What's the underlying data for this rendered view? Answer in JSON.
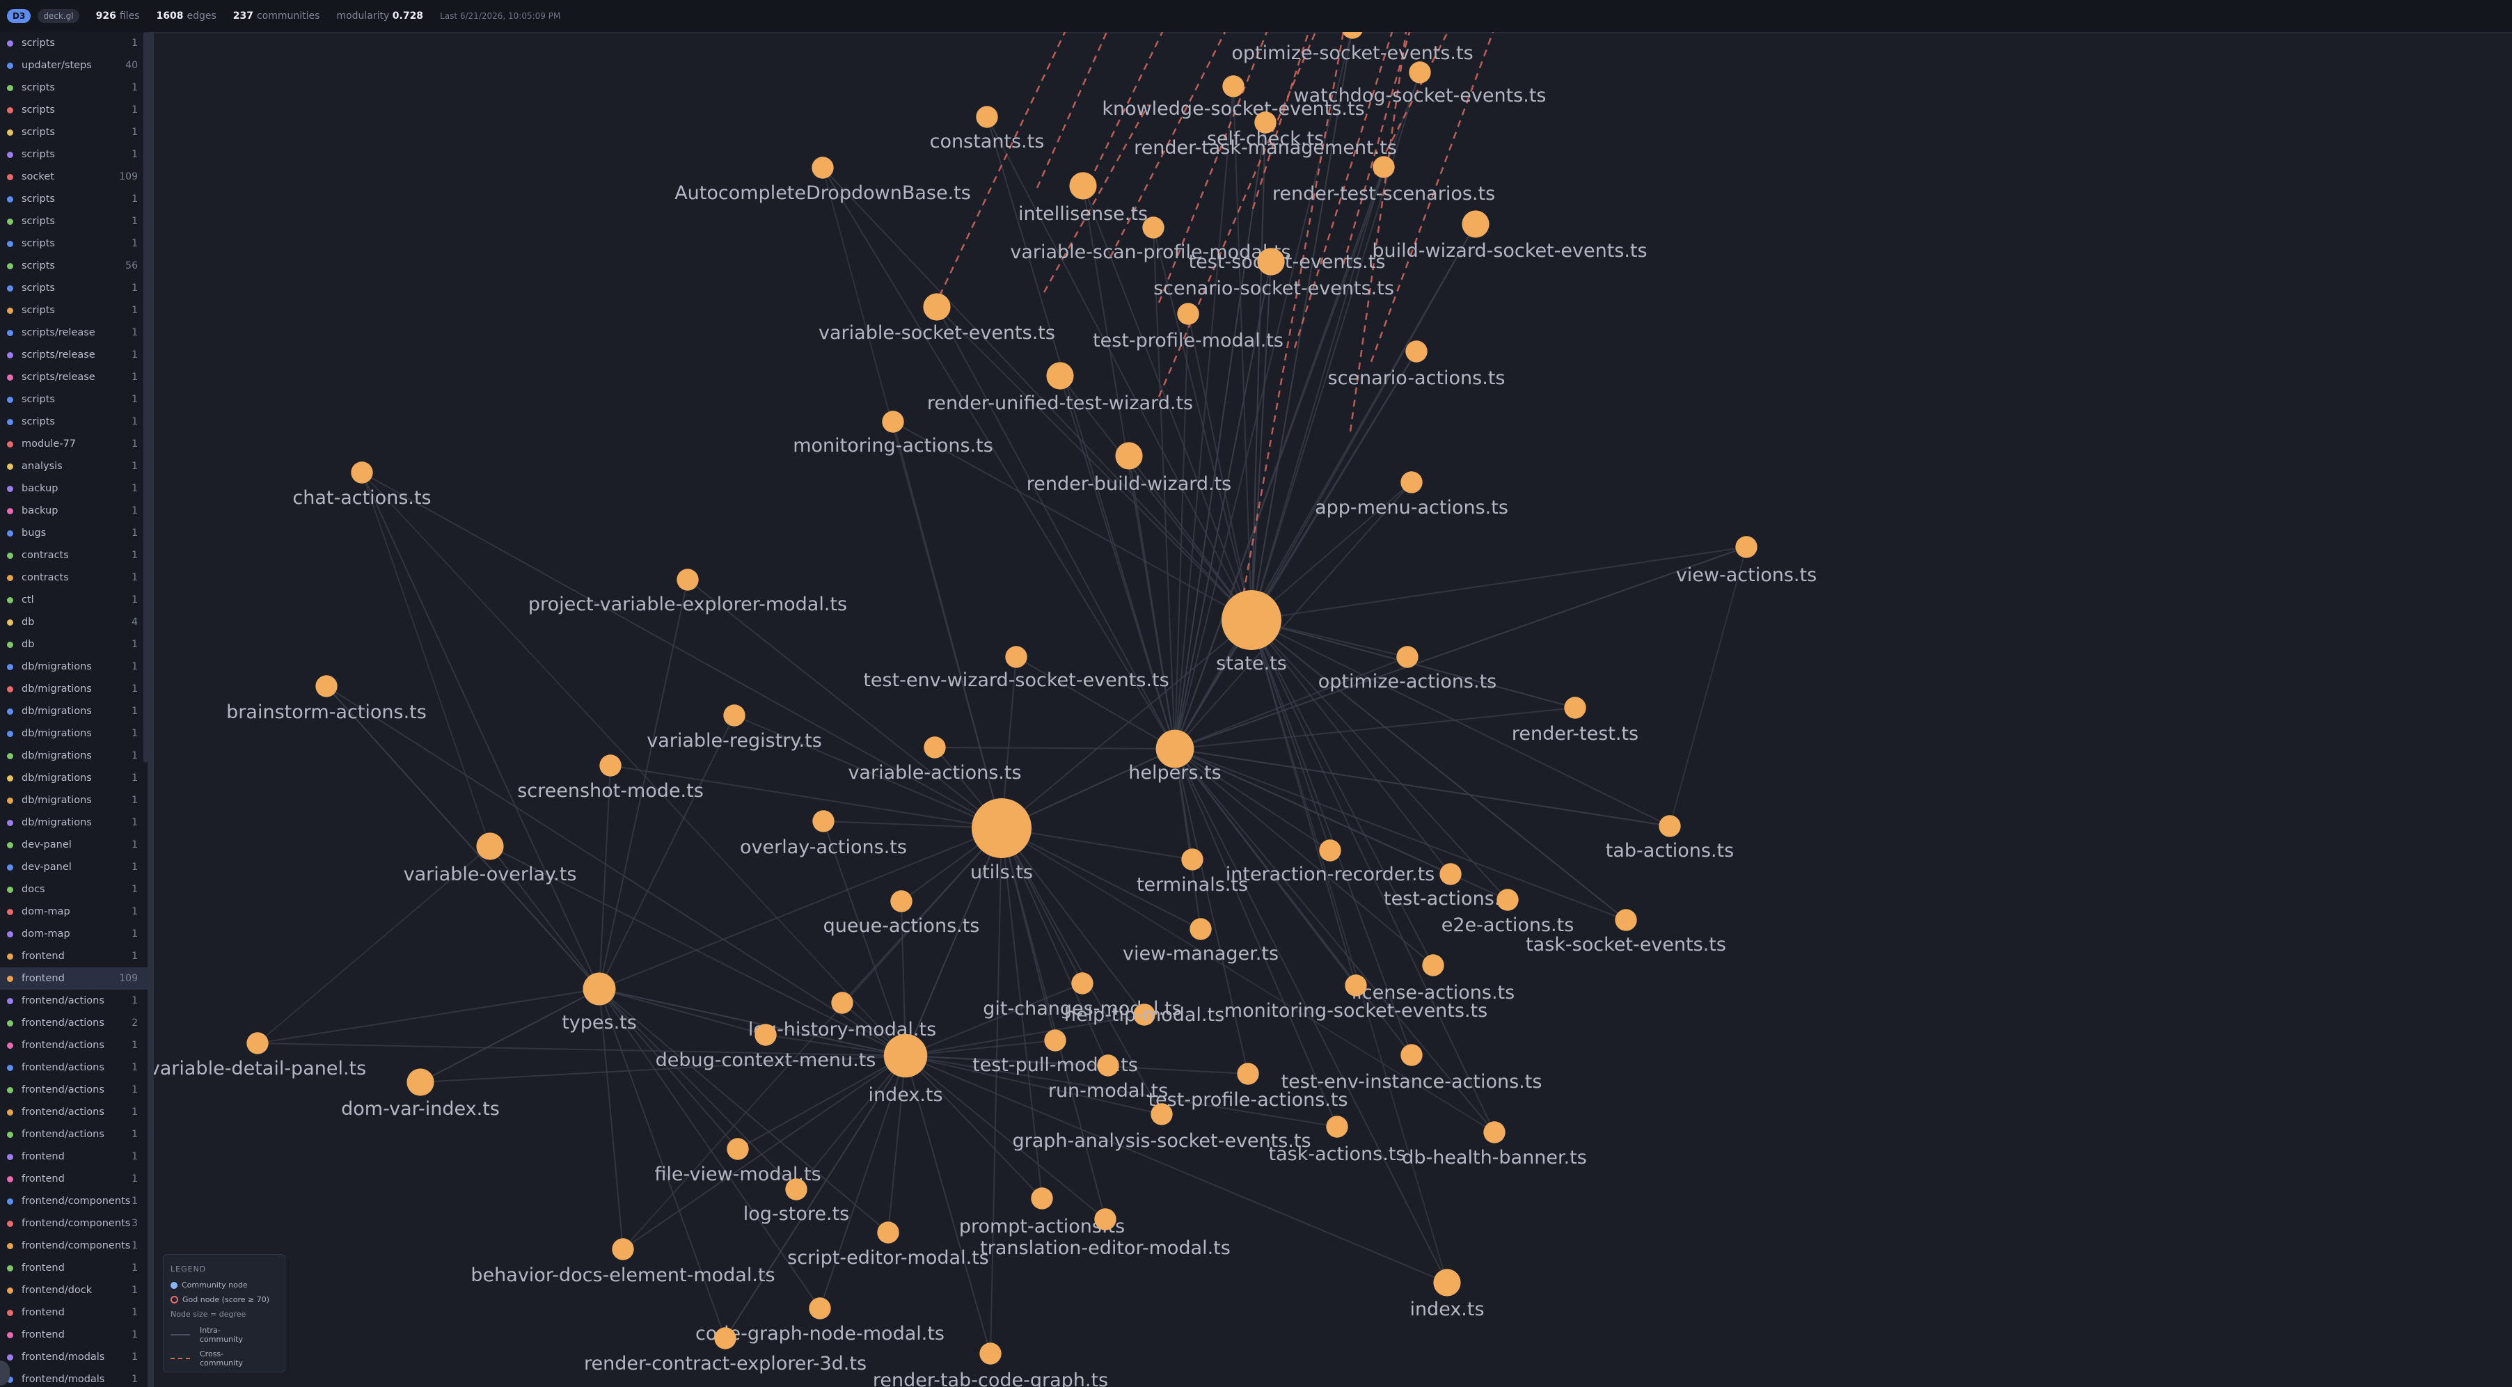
{
  "topbar": {
    "tabs": [
      {
        "label": "D3",
        "active": true
      },
      {
        "label": "deck.gl",
        "active": false
      }
    ],
    "stats": [
      {
        "value": "926",
        "label": "files"
      },
      {
        "value": "1608",
        "label": "edges"
      },
      {
        "value": "237",
        "label": "communities"
      },
      {
        "label": "modularity",
        "value": "0.728"
      }
    ],
    "last_updated": "Last 6/21/2026, 10:05:09 PM"
  },
  "sidebar": {
    "items": [
      {
        "name": "scripts",
        "count": "1",
        "color": "#9b7bf0"
      },
      {
        "name": "updater/steps",
        "count": "40",
        "color": "#5d8df0"
      },
      {
        "name": "scripts",
        "count": "1",
        "color": "#7ec86a"
      },
      {
        "name": "scripts",
        "count": "1",
        "color": "#e86a6a"
      },
      {
        "name": "scripts",
        "count": "1",
        "color": "#e8c25a"
      },
      {
        "name": "scripts",
        "count": "1",
        "color": "#9b7bf0"
      },
      {
        "name": "socket",
        "count": "109",
        "color": "#e86a6a"
      },
      {
        "name": "scripts",
        "count": "1",
        "color": "#5d8df0"
      },
      {
        "name": "scripts",
        "count": "1",
        "color": "#7ec86a"
      },
      {
        "name": "scripts",
        "count": "1",
        "color": "#5d8df0"
      },
      {
        "name": "scripts",
        "count": "56",
        "color": "#7ec86a"
      },
      {
        "name": "scripts",
        "count": "1",
        "color": "#5d8df0"
      },
      {
        "name": "scripts",
        "count": "1",
        "color": "#e8a44a"
      },
      {
        "name": "scripts/release",
        "count": "1",
        "color": "#5d8df0"
      },
      {
        "name": "scripts/release",
        "count": "1",
        "color": "#9b7bf0"
      },
      {
        "name": "scripts/release",
        "count": "1",
        "color": "#e86ab0"
      },
      {
        "name": "scripts",
        "count": "1",
        "color": "#5d8df0"
      },
      {
        "name": "scripts",
        "count": "1",
        "color": "#5d8df0"
      },
      {
        "name": "module-77",
        "count": "1",
        "color": "#e86a6a"
      },
      {
        "name": "analysis",
        "count": "1",
        "color": "#e8c25a"
      },
      {
        "name": "backup",
        "count": "1",
        "color": "#9b7bf0"
      },
      {
        "name": "backup",
        "count": "1",
        "color": "#e86ab0"
      },
      {
        "name": "bugs",
        "count": "1",
        "color": "#5d8df0"
      },
      {
        "name": "contracts",
        "count": "1",
        "color": "#7ec86a"
      },
      {
        "name": "contracts",
        "count": "1",
        "color": "#e8a44a"
      },
      {
        "name": "ctl",
        "count": "1",
        "color": "#7ec86a"
      },
      {
        "name": "db",
        "count": "4",
        "color": "#e8c25a"
      },
      {
        "name": "db",
        "count": "1",
        "color": "#7ec86a"
      },
      {
        "name": "db/migrations",
        "count": "1",
        "color": "#5d8df0"
      },
      {
        "name": "db/migrations",
        "count": "1",
        "color": "#e86a6a"
      },
      {
        "name": "db/migrations",
        "count": "1",
        "color": "#5d8df0"
      },
      {
        "name": "db/migrations",
        "count": "1",
        "color": "#5d8df0"
      },
      {
        "name": "db/migrations",
        "count": "1",
        "color": "#7ec86a"
      },
      {
        "name": "db/migrations",
        "count": "1",
        "color": "#e8c25a"
      },
      {
        "name": "db/migrations",
        "count": "1",
        "color": "#e8a44a"
      },
      {
        "name": "db/migrations",
        "count": "1",
        "color": "#9b7bf0"
      },
      {
        "name": "dev-panel",
        "count": "1",
        "color": "#7ec86a"
      },
      {
        "name": "dev-panel",
        "count": "1",
        "color": "#5d8df0"
      },
      {
        "name": "docs",
        "count": "1",
        "color": "#7ec86a"
      },
      {
        "name": "dom-map",
        "count": "1",
        "color": "#e86a6a"
      },
      {
        "name": "dom-map",
        "count": "1",
        "color": "#9b7bf0"
      },
      {
        "name": "frontend",
        "count": "1",
        "color": "#e8a44a"
      },
      {
        "name": "frontend",
        "count": "109",
        "color": "#e8a44a"
      },
      {
        "name": "frontend/actions",
        "count": "1",
        "color": "#9b7bf0"
      },
      {
        "name": "frontend/actions",
        "count": "2",
        "color": "#7ec86a"
      },
      {
        "name": "frontend/actions",
        "count": "1",
        "color": "#e86ab0"
      },
      {
        "name": "frontend/actions",
        "count": "1",
        "color": "#5d8df0"
      },
      {
        "name": "frontend/actions",
        "count": "1",
        "color": "#7ec86a"
      },
      {
        "name": "frontend/actions",
        "count": "1",
        "color": "#e8a44a"
      },
      {
        "name": "frontend/actions",
        "count": "1",
        "color": "#7ec86a"
      },
      {
        "name": "frontend",
        "count": "1",
        "color": "#9b7bf0"
      },
      {
        "name": "frontend",
        "count": "1",
        "color": "#e86ab0"
      },
      {
        "name": "frontend/components",
        "count": "1",
        "color": "#5d8df0"
      },
      {
        "name": "frontend/components",
        "count": "3",
        "color": "#e86a6a"
      },
      {
        "name": "frontend/components",
        "count": "1",
        "color": "#e8a44a"
      },
      {
        "name": "frontend",
        "count": "1",
        "color": "#7ec86a"
      },
      {
        "name": "frontend/dock",
        "count": "1",
        "color": "#e8a44a"
      },
      {
        "name": "frontend",
        "count": "1",
        "color": "#e86a6a"
      },
      {
        "name": "frontend",
        "count": "1",
        "color": "#e86ab0"
      },
      {
        "name": "frontend/modals",
        "count": "1",
        "color": "#9b7bf0"
      },
      {
        "name": "frontend/modals",
        "count": "1",
        "color": "#5d8df0"
      }
    ]
  },
  "graph": {
    "node_color": "#f2ac5c",
    "intra_edge_color": "#3a3d49",
    "cross_edge_color": "#d6685f",
    "nodes": [
      {
        "label": "optimize-socket-events.ts",
        "degree": 3
      },
      {
        "label": "watchdog-socket-events.ts",
        "degree": 3
      },
      {
        "label": "knowledge-socket-events.ts",
        "degree": 3
      },
      {
        "label": "self-check.ts",
        "degree": 3
      },
      {
        "label": "render-task-management.ts",
        "degree": 3
      },
      {
        "label": "constants.ts",
        "degree": 3
      },
      {
        "label": "AutocompleteDropdownBase.ts",
        "degree": 3
      },
      {
        "label": "intellisense.ts",
        "degree": 4
      },
      {
        "label": "render-test-scenarios.ts",
        "degree": 3
      },
      {
        "label": "variable-scan-profile-modal.ts",
        "degree": 3
      },
      {
        "label": "test-socket-events.ts",
        "degree": 4
      },
      {
        "label": "build-wizard-socket-events.ts",
        "degree": 4
      },
      {
        "label": "scenario-socket-events.ts",
        "degree": 4
      },
      {
        "label": "variable-socket-events.ts",
        "degree": 4
      },
      {
        "label": "test-profile-modal.ts",
        "degree": 3
      },
      {
        "label": "scenario-actions.ts",
        "degree": 3
      },
      {
        "label": "render-unified-test-wizard.ts",
        "degree": 4
      },
      {
        "label": "monitoring-actions.ts",
        "degree": 3
      },
      {
        "label": "render-build-wizard.ts",
        "degree": 4
      },
      {
        "label": "chat-actions.ts",
        "degree": 3
      },
      {
        "label": "app-menu-actions.ts",
        "degree": 3
      },
      {
        "label": "view-actions.ts",
        "degree": 3
      },
      {
        "label": "project-variable-explorer-modal.ts",
        "degree": 3
      },
      {
        "label": "state.ts",
        "degree": 10
      },
      {
        "label": "test-env-wizard-socket-events.ts",
        "degree": 3
      },
      {
        "label": "optimize-actions.ts",
        "degree": 3
      },
      {
        "label": "brainstorm-actions.ts",
        "degree": 3
      },
      {
        "label": "variable-registry.ts",
        "degree": 3
      },
      {
        "label": "render-test.ts",
        "degree": 3
      },
      {
        "label": "variable-actions.ts",
        "degree": 3
      },
      {
        "label": "helpers.ts",
        "degree": 6
      },
      {
        "label": "screenshot-mode.ts",
        "degree": 3
      },
      {
        "label": "tab-actions.ts",
        "degree": 3
      },
      {
        "label": "overlay-actions.ts",
        "degree": 3
      },
      {
        "label": "utils.ts",
        "degree": 10
      },
      {
        "label": "variable-overlay.ts",
        "degree": 4
      },
      {
        "label": "terminals.ts",
        "degree": 3
      },
      {
        "label": "interaction-recorder.ts",
        "degree": 3
      },
      {
        "label": "test-actions.ts",
        "degree": 3
      },
      {
        "label": "e2e-actions.ts",
        "degree": 3
      },
      {
        "label": "queue-actions.ts",
        "degree": 3
      },
      {
        "label": "task-socket-events.ts",
        "degree": 3
      },
      {
        "label": "view-manager.ts",
        "degree": 3
      },
      {
        "label": "license-actions.ts",
        "degree": 3
      },
      {
        "label": "types.ts",
        "degree": 5
      },
      {
        "label": "git-changes-modal.ts",
        "degree": 3
      },
      {
        "label": "monitoring-socket-events.ts",
        "degree": 3
      },
      {
        "label": "log-history-modal.ts",
        "degree": 3
      },
      {
        "label": "help-tip-modal.ts",
        "degree": 3
      },
      {
        "label": "debug-context-menu.ts",
        "degree": 3
      },
      {
        "label": "index.ts",
        "degree": 7
      },
      {
        "label": "test-pull-modal.ts",
        "degree": 3
      },
      {
        "label": "variable-detail-panel.ts",
        "degree": 3
      },
      {
        "label": "run-modal.ts",
        "degree": 3
      },
      {
        "label": "test-env-instance-actions.ts",
        "degree": 3
      },
      {
        "label": "dom-var-index.ts",
        "degree": 4
      },
      {
        "label": "test-profile-actions.ts",
        "degree": 3
      },
      {
        "label": "graph-analysis-socket-events.ts",
        "degree": 3
      },
      {
        "label": "task-actions.ts",
        "degree": 3
      },
      {
        "label": "db-health-banner.ts",
        "degree": 3
      },
      {
        "label": "file-view-modal.ts",
        "degree": 3
      },
      {
        "label": "log-store.ts",
        "degree": 3
      },
      {
        "label": "prompt-actions.ts",
        "degree": 3
      },
      {
        "label": "translation-editor-modal.ts",
        "degree": 3
      },
      {
        "label": "script-editor-modal.ts",
        "degree": 3
      },
      {
        "label": "behavior-docs-element-modal.ts",
        "degree": 3
      },
      {
        "label": "index.ts",
        "degree": 4
      },
      {
        "label": "code-graph-node-modal.ts",
        "degree": 3
      },
      {
        "label": "render-contract-explorer-3d.ts",
        "degree": 3
      },
      {
        "label": "render-tab-code-graph.ts",
        "degree": 3
      }
    ]
  },
  "legend": {
    "title": "LEGEND",
    "community_node": "Community node",
    "god_node": "God node (score ≥ 70)",
    "size_note": "Node size = degree",
    "intra": "Intra-community",
    "cross": "Cross-community"
  }
}
